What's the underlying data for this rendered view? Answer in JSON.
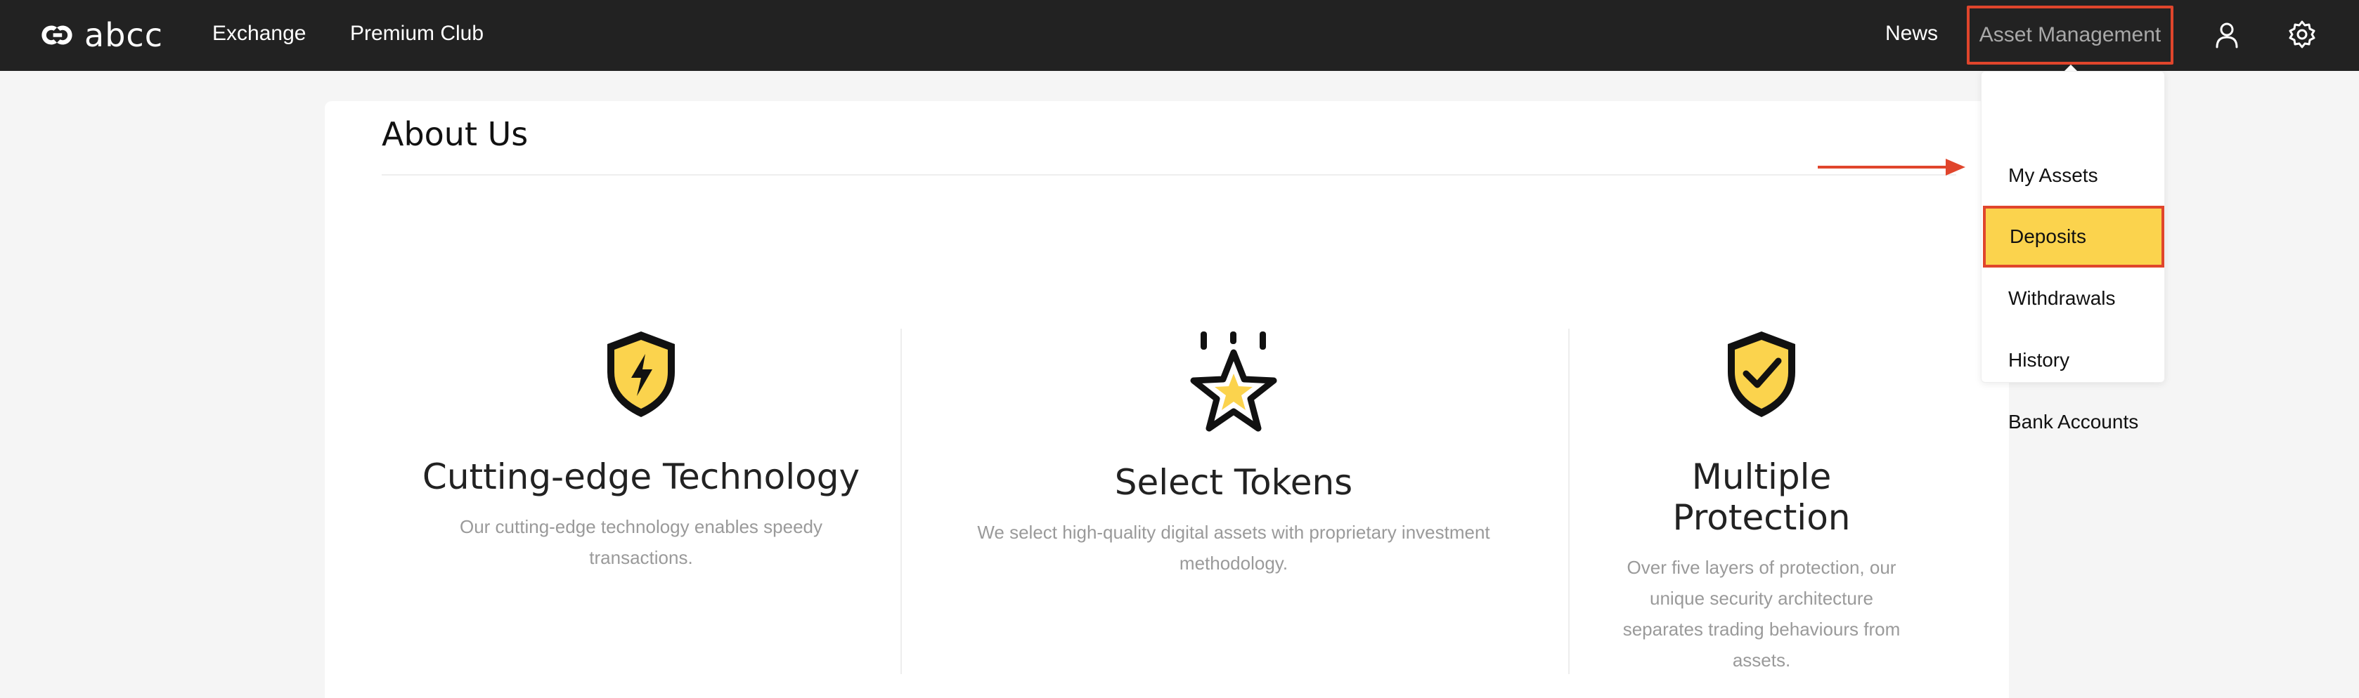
{
  "app": {
    "logo_text": "abcc",
    "brand_accent": "#fbd34d",
    "highlight_border": "#e0452c"
  },
  "nav": {
    "exchange": "Exchange",
    "premium_club": "Premium Club",
    "news": "News",
    "asset_management": "Asset Management",
    "user_icon": "user-icon",
    "settings_icon": "gear-icon"
  },
  "dropdown": {
    "items": [
      {
        "label": "My Assets"
      },
      {
        "label": "Deposits",
        "highlighted": true
      },
      {
        "label": "Withdrawals"
      },
      {
        "label": "History"
      },
      {
        "label": "Bank Accounts"
      }
    ]
  },
  "about": {
    "title": "About Us",
    "features": [
      {
        "icon": "shield-lightning-icon",
        "title": "Cutting-edge Technology",
        "desc_lines": [
          "Our cutting-edge technology enables speedy",
          "transactions."
        ]
      },
      {
        "icon": "star-icon",
        "title": "Select Tokens",
        "desc_lines": [
          "We select high-quality digital assets with proprietary investment",
          "methodology."
        ]
      },
      {
        "icon": "shield-check-icon",
        "title_lines": [
          "Multiple",
          "Protection"
        ],
        "desc_lines": [
          "Over five layers of protection, our",
          "unique security architecture",
          "separates trading behaviours from",
          "assets."
        ]
      }
    ]
  }
}
